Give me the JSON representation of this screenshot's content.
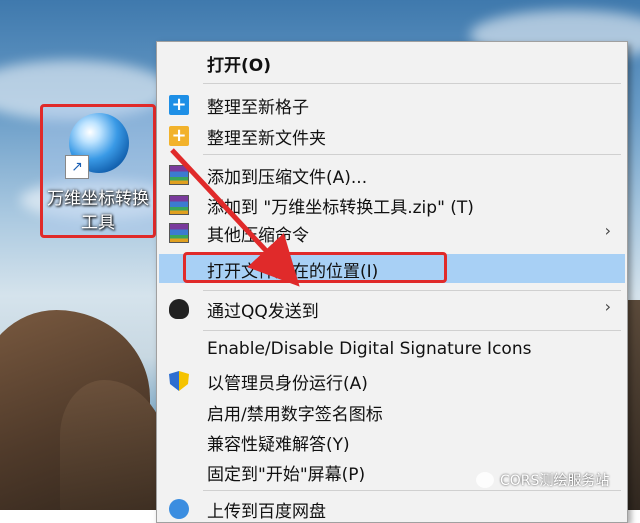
{
  "desktop": {
    "icon_label": "万维坐标转换工具",
    "icon_label_line1": "万维坐标转换",
    "icon_label_line2": "工具"
  },
  "context_menu": {
    "items": [
      {
        "label": "打开(O)",
        "bold": true
      },
      {
        "label": "整理至新格子",
        "icon": "plus-blue-icon"
      },
      {
        "label": "整理至新文件夹",
        "icon": "plus-yellow-icon"
      },
      {
        "label": "添加到压缩文件(A)...",
        "icon": "winrar-icon"
      },
      {
        "label": "添加到 \"万维坐标转换工具.zip\" (T)",
        "icon": "winrar-icon"
      },
      {
        "label": "其他压缩命令",
        "icon": "winrar-icon",
        "submenu": "›"
      },
      {
        "label": "打开文件所在的位置(I)",
        "highlighted": true
      },
      {
        "label": "通过QQ发送到",
        "icon": "qq-icon",
        "submenu": "›"
      },
      {
        "label": "Enable/Disable Digital Signature Icons"
      },
      {
        "label": "以管理员身份运行(A)",
        "icon": "uac-shield-icon"
      },
      {
        "label": "启用/禁用数字签名图标"
      },
      {
        "label": "兼容性疑难解答(Y)"
      },
      {
        "label": "固定到\"开始\"屏幕(P)"
      },
      {
        "label": "上传到百度网盘",
        "icon": "baidu-cloud-icon"
      }
    ]
  },
  "watermark": {
    "text": "CORS测绘服务站"
  },
  "colors": {
    "highlight": "#a8d0f5",
    "annotation_red": "#e02a2a",
    "menu_bg": "#f2f2f2"
  }
}
